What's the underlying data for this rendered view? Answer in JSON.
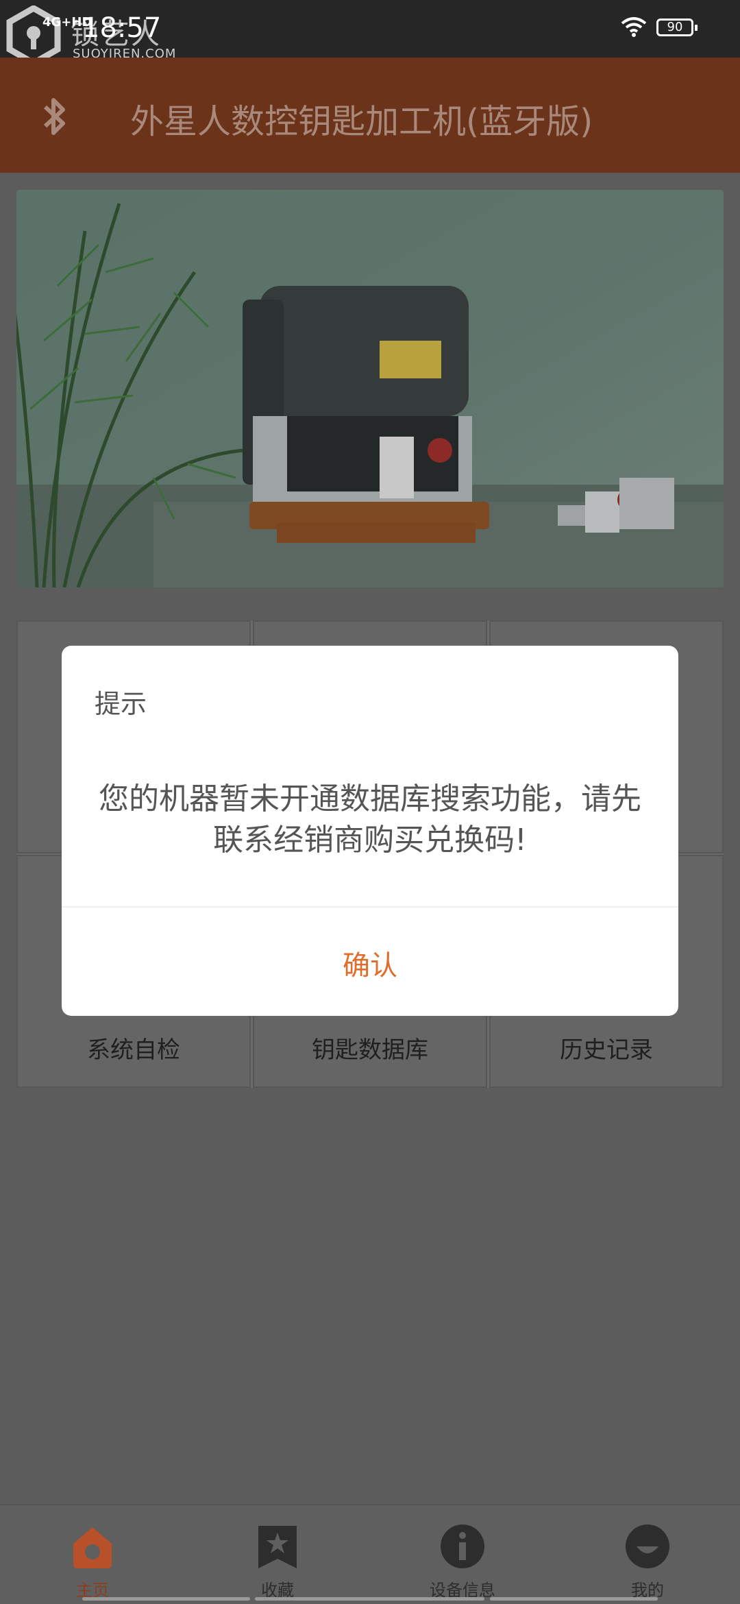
{
  "status_bar": {
    "time": "18:57",
    "network": "4G+HD",
    "battery": "90",
    "watermark_cn": "锁艺人",
    "watermark_en": "SUOYIREN.COM"
  },
  "app_bar": {
    "title": "外星人数控钥匙加工机(蓝牙版)",
    "bluetooth_icon": "bluetooth-icon"
  },
  "banner": {
    "image": "key-cutting-machine-photo"
  },
  "grid": {
    "items": [
      {
        "label": ""
      },
      {
        "label": ""
      },
      {
        "label": ""
      },
      {
        "label": "系统自检"
      },
      {
        "label": "钥匙数据库"
      },
      {
        "label": "历史记录"
      }
    ]
  },
  "dialog": {
    "title": "提示",
    "message_line1": "您的机器暂未开通数据库搜索功能，请先",
    "message_line2": "联系经销商购买兑换码!",
    "confirm": "确认"
  },
  "bottom_nav": {
    "items": [
      {
        "label": "主页",
        "icon": "home-icon",
        "active": true
      },
      {
        "label": "收藏",
        "icon": "favorites-icon",
        "active": false
      },
      {
        "label": "设备信息",
        "icon": "info-icon",
        "active": false
      },
      {
        "label": "我的",
        "icon": "profile-icon",
        "active": false
      }
    ]
  },
  "colors": {
    "accent": "#e06d2c",
    "app_bar_dimmed": "#6b341a",
    "active_nav": "#b8502a"
  }
}
